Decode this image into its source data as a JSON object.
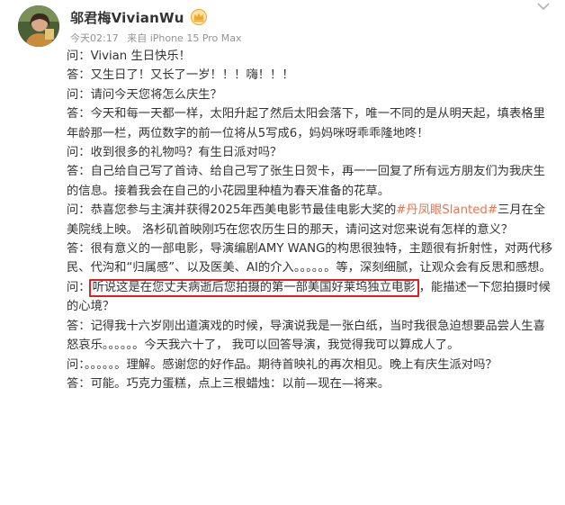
{
  "post": {
    "author": {
      "name": "邬君梅VivianWu",
      "badge_icon": "vip-crown-icon",
      "badge_color": "#f5a623"
    },
    "meta": {
      "time": "今天02:17",
      "source": "来自 iPhone 15 Pro Max"
    },
    "menu_icon": "chevron-down-icon",
    "colors": {
      "hashtag": "#eb7350",
      "highlight_border": "#e02020",
      "text": "#333333",
      "meta": "#939393"
    },
    "lines": [
      "问：Vivian 生日快乐！",
      "答：又生日了！又长了一岁！！！嗨！！！",
      "问：请问今天您将怎么庆生？",
      "答：今天和每一天都一样，太阳升起了然后太阳会落下，唯一不同的是从明天起，填表格里年龄那一栏，两位数字的前一位将从5写成6，妈妈咪呀乖乖隆地咚！",
      "问：收到很多的礼物吗？有生日派对吗？",
      "答：自己给自己写了首诗、给自己写了张生日贺卡，再一一回复了所有远方朋友们为我庆生的信息。接着我会在自己的小花园里种植为春天准备的花草。"
    ],
    "q_slanted": {
      "before": "问：恭喜您参与主演并获得2025年西美电影节最佳电影大奖的",
      "hashtag": "#丹凤眼Slanted#",
      "after": "三月在全美院线上映。 洛杉矶首映刚巧在您农历生日的那天，请问这对您来说有怎样的意义？"
    },
    "a_slanted": "答：很有意义的一部电影，导演编剧AMY WANG的构思很独特，主题很有折射性，对两代移民、代沟和“归属感”、以及医美、AI的介入。。。。。。等，深刻细腻，让观众会有反思和感想。",
    "q_husband": {
      "prefix": "问：",
      "highlight": "听说这是在您丈夫病逝后您拍摄的第一部美国好莱坞独立电影",
      "suffix": "，能描述一下您拍摄时候的心境？"
    },
    "lines_end": [
      "答：记得我十六岁刚出道演戏的时候，导演说我是一张白纸，当时我很急迫想要品尝人生喜怒哀乐。。。。。。今天我六十了， 我可以回答导演，我觉得我可以算成人了。",
      "问：。。。。。。理解。感谢您的好作品。期待首映礼的再次相见。晚上有庆生派对吗？",
      "答：可能。巧克力蛋糕，点上三根蜡烛：以前—现在—将来。"
    ]
  }
}
